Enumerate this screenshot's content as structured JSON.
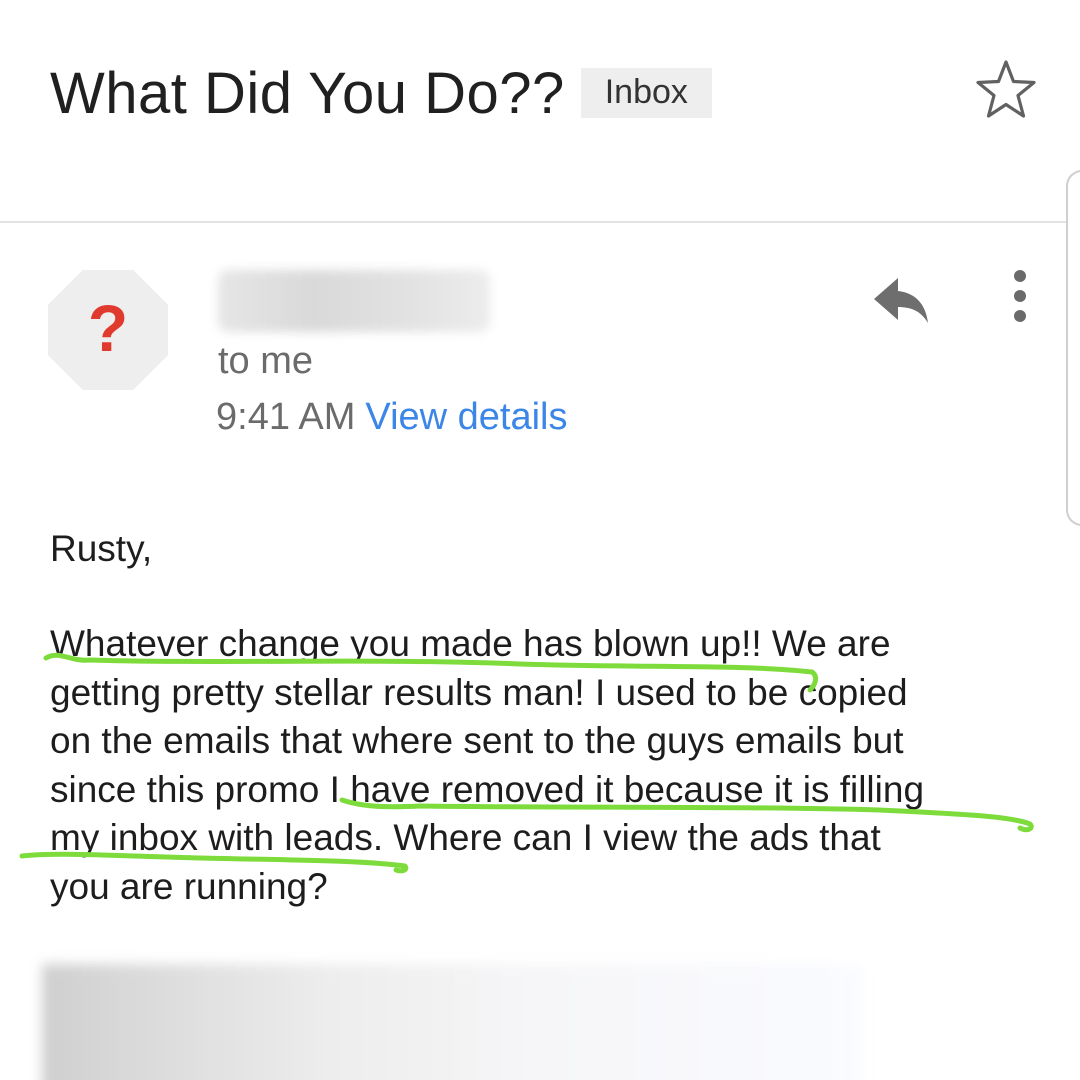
{
  "header": {
    "subject": "What Did You Do??",
    "label": "Inbox",
    "star_icon": "star-outline-icon"
  },
  "sender": {
    "avatar_glyph": "?",
    "avatar_color": "#e03a2e",
    "recipient": "to me",
    "time": "9:41 AM",
    "details_link": "View details",
    "link_color": "#3b86e6",
    "reply_icon": "reply-icon",
    "more_icon": "more-vert-icon"
  },
  "message": {
    "greeting": "Rusty,",
    "lines": [
      "Whatever change you made has blown up!! We are",
      "getting pretty stellar results man! I used to be copied",
      "on the emails that where sent to the guys emails but",
      "since this promo I have removed it because it is filling",
      "my inbox with leads. Where can I view the ads that",
      "you are running?"
    ],
    "highlight_color": "#7ddc3c"
  }
}
